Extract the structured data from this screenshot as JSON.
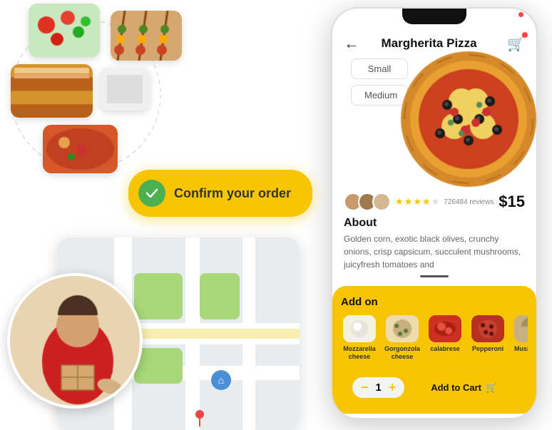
{
  "app": {
    "title": "Margherita Pizza",
    "back_label": "←",
    "cart_icon": "🛒"
  },
  "sizes": [
    "Small",
    "Medium"
  ],
  "price": "$15",
  "reviews": {
    "count": "726484 reviews",
    "stars": 4
  },
  "about": {
    "title": "About",
    "text": "Golden corn, exotic black olives, crunchy onions, crisp capsicum, succulent mushrooms, juicyfresh tomatoes and"
  },
  "addons": {
    "title": "Add on",
    "items": [
      {
        "label": "Mozzarella cheese",
        "color": "#f0ece0"
      },
      {
        "label": "Gorgonzola cheese",
        "color": "#e8d4b0"
      },
      {
        "label": "calabrese",
        "color": "#d44040"
      },
      {
        "label": "Pepperoni",
        "color": "#c84040"
      },
      {
        "label": "Mushroom",
        "color": "#c8b090"
      }
    ]
  },
  "quantity": {
    "minus": "−",
    "value": "1",
    "plus": "+"
  },
  "add_to_cart": "Add to Cart",
  "confirm_order": "Confirm your order",
  "delivery_map": {
    "home_icon": "🏠",
    "pin_icon": "📍"
  }
}
